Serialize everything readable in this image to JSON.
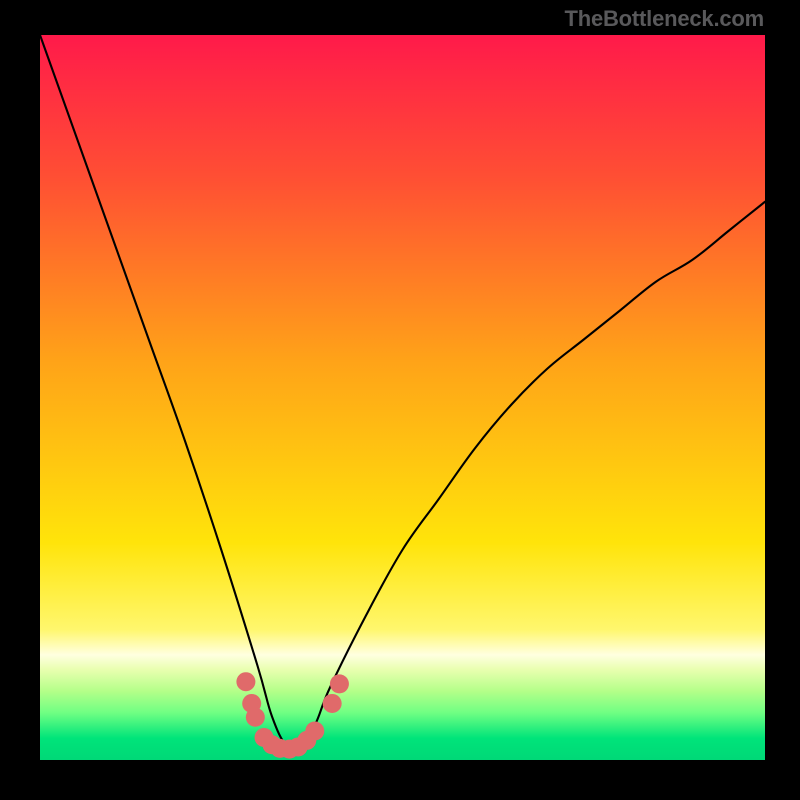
{
  "watermark": "TheBottleneck.com",
  "chart_data": {
    "type": "line",
    "title": "",
    "xlabel": "",
    "ylabel": "",
    "xlim": [
      0,
      100
    ],
    "ylim": [
      0,
      100
    ],
    "grid": false,
    "series": [
      {
        "name": "bottleneck-curve",
        "x": [
          0,
          5,
          10,
          15,
          20,
          25,
          30,
          32,
          34,
          36,
          38,
          40,
          45,
          50,
          55,
          60,
          65,
          70,
          75,
          80,
          85,
          90,
          95,
          100
        ],
        "values": [
          100,
          86,
          72,
          58,
          44,
          29,
          13,
          6,
          2,
          2,
          5,
          10,
          20,
          29,
          36,
          43,
          49,
          54,
          58,
          62,
          66,
          69,
          73,
          77
        ]
      }
    ],
    "markers": {
      "name": "sweet-spot-markers",
      "color": "#e06a6a",
      "points": [
        {
          "x": 28.4,
          "y": 10.8
        },
        {
          "x": 29.2,
          "y": 7.8
        },
        {
          "x": 29.7,
          "y": 5.9
        },
        {
          "x": 30.9,
          "y": 3.1
        },
        {
          "x": 32.0,
          "y": 2.1
        },
        {
          "x": 33.1,
          "y": 1.6
        },
        {
          "x": 34.4,
          "y": 1.5
        },
        {
          "x": 35.6,
          "y": 1.8
        },
        {
          "x": 36.8,
          "y": 2.7
        },
        {
          "x": 37.9,
          "y": 4.0
        },
        {
          "x": 40.3,
          "y": 7.8
        },
        {
          "x": 41.3,
          "y": 10.5
        }
      ]
    },
    "background_gradient": {
      "stops": [
        {
          "pos": 0.0,
          "color": "#ff1a4a"
        },
        {
          "pos": 0.2,
          "color": "#ff5033"
        },
        {
          "pos": 0.45,
          "color": "#ffa318"
        },
        {
          "pos": 0.7,
          "color": "#ffe40a"
        },
        {
          "pos": 0.82,
          "color": "#fff76d"
        },
        {
          "pos": 0.855,
          "color": "#ffffe0"
        },
        {
          "pos": 0.875,
          "color": "#e9ffb0"
        },
        {
          "pos": 0.905,
          "color": "#b4ff89"
        },
        {
          "pos": 0.935,
          "color": "#6fff83"
        },
        {
          "pos": 0.97,
          "color": "#00e47a"
        },
        {
          "pos": 1.0,
          "color": "#00d877"
        }
      ]
    }
  }
}
